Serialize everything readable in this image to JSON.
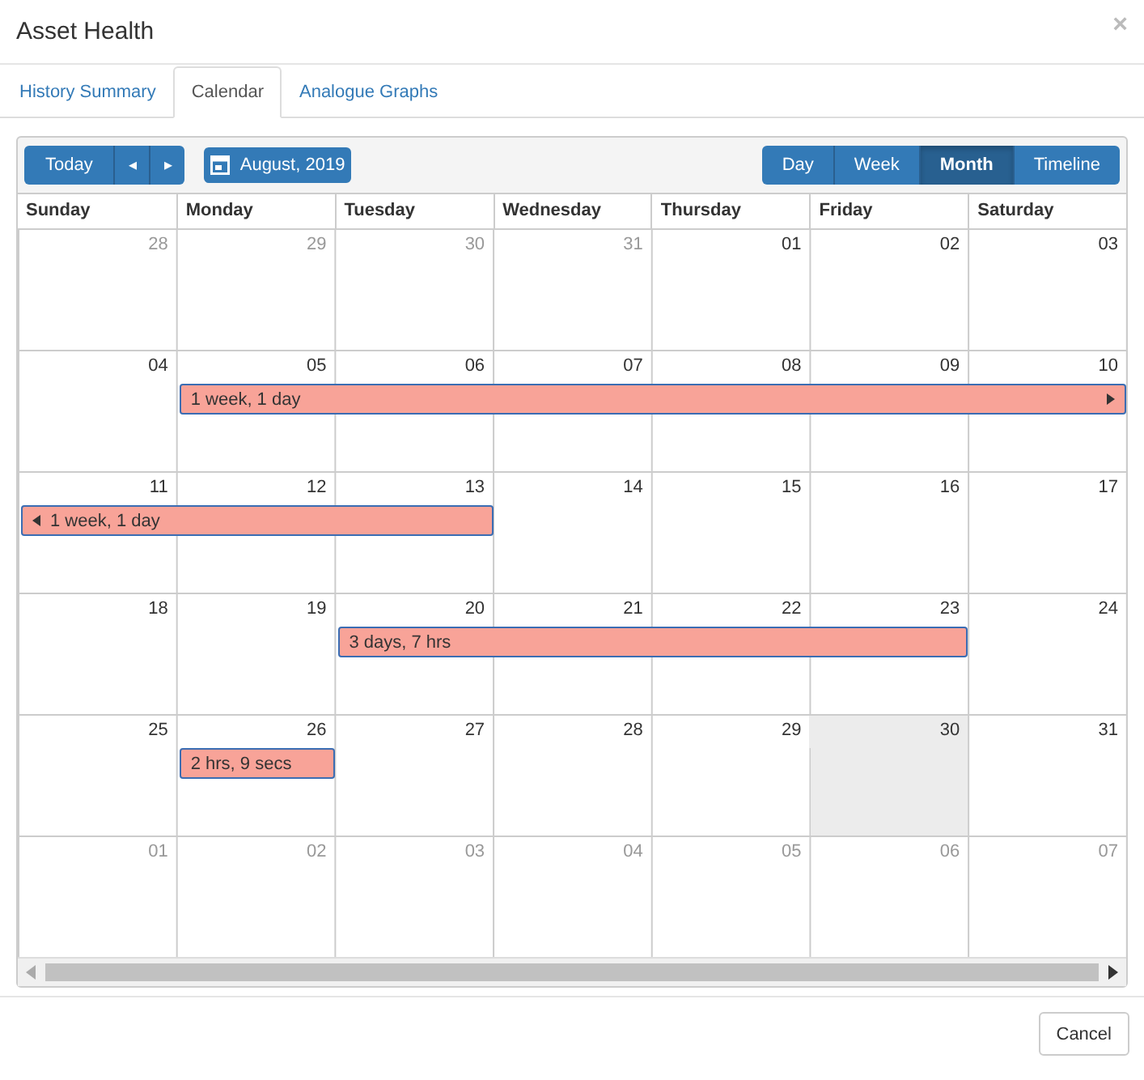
{
  "window": {
    "title": "Asset Health",
    "close": "×"
  },
  "tabs": [
    {
      "label": "History Summary",
      "selected": false
    },
    {
      "label": "Calendar",
      "selected": true
    },
    {
      "label": "Analogue Graphs",
      "selected": false
    }
  ],
  "toolbar": {
    "today": "Today",
    "prev": "◂",
    "next": "▸",
    "date": "August, 2019",
    "views": [
      {
        "label": "Day",
        "selected": false
      },
      {
        "label": "Week",
        "selected": false
      },
      {
        "label": "Month",
        "selected": true
      },
      {
        "label": "Timeline",
        "selected": false
      }
    ]
  },
  "weekdays": [
    "Sunday",
    "Monday",
    "Tuesday",
    "Wednesday",
    "Thursday",
    "Friday",
    "Saturday"
  ],
  "weeks": [
    {
      "days": [
        {
          "label": "28",
          "muted": true,
          "today": false
        },
        {
          "label": "29",
          "muted": true,
          "today": false
        },
        {
          "label": "30",
          "muted": true,
          "today": false
        },
        {
          "label": "31",
          "muted": true,
          "today": false
        },
        {
          "label": "01",
          "muted": false,
          "today": false
        },
        {
          "label": "02",
          "muted": false,
          "today": false
        },
        {
          "label": "03",
          "muted": false,
          "today": false
        }
      ]
    },
    {
      "days": [
        {
          "label": "04",
          "muted": false,
          "today": false,
          "in_event": false
        },
        {
          "label": "05",
          "muted": false,
          "today": false,
          "in_event": true
        },
        {
          "label": "06",
          "muted": false,
          "today": false,
          "in_event": true
        },
        {
          "label": "07",
          "muted": false,
          "today": false,
          "in_event": true
        },
        {
          "label": "08",
          "muted": false,
          "today": false,
          "in_event": true
        },
        {
          "label": "09",
          "muted": false,
          "today": false,
          "in_event": true
        },
        {
          "label": "10",
          "muted": false,
          "today": false,
          "in_event": true
        }
      ],
      "event": {
        "label": "1 week, 1 day",
        "continues_before": false,
        "continues_after": true
      }
    },
    {
      "days": [
        {
          "label": "11",
          "muted": false,
          "today": false,
          "in_event": true
        },
        {
          "label": "12",
          "muted": false,
          "today": false,
          "in_event": true
        },
        {
          "label": "13",
          "muted": false,
          "today": false,
          "in_event": true
        },
        {
          "label": "14",
          "muted": false,
          "today": false,
          "in_event": false
        },
        {
          "label": "15",
          "muted": false,
          "today": false,
          "in_event": false
        },
        {
          "label": "16",
          "muted": false,
          "today": false,
          "in_event": false
        },
        {
          "label": "17",
          "muted": false,
          "today": false,
          "in_event": false
        }
      ],
      "event": {
        "label": "1 week, 1 day",
        "continues_before": true,
        "continues_after": false
      }
    },
    {
      "days": [
        {
          "label": "18",
          "muted": false,
          "today": false,
          "in_event": false
        },
        {
          "label": "19",
          "muted": false,
          "today": false,
          "in_event": false
        },
        {
          "label": "20",
          "muted": false,
          "today": false,
          "in_event": true
        },
        {
          "label": "21",
          "muted": false,
          "today": false,
          "in_event": true
        },
        {
          "label": "22",
          "muted": false,
          "today": false,
          "in_event": true
        },
        {
          "label": "23",
          "muted": false,
          "today": false,
          "in_event": true
        },
        {
          "label": "24",
          "muted": false,
          "today": false,
          "in_event": false
        }
      ],
      "event": {
        "label": "3 days, 7 hrs",
        "continues_before": false,
        "continues_after": false
      }
    },
    {
      "days": [
        {
          "label": "25",
          "muted": false,
          "today": false,
          "in_event": false
        },
        {
          "label": "26",
          "muted": false,
          "today": false,
          "in_event": true
        },
        {
          "label": "27",
          "muted": false,
          "today": false,
          "in_event": false
        },
        {
          "label": "28",
          "muted": false,
          "today": false,
          "in_event": false
        },
        {
          "label": "29",
          "muted": false,
          "today": false,
          "in_event": false
        },
        {
          "label": "30",
          "muted": false,
          "today": true,
          "in_event": false
        },
        {
          "label": "31",
          "muted": false,
          "today": false,
          "in_event": false
        }
      ],
      "event": {
        "label": "2 hrs, 9 secs",
        "continues_before": false,
        "continues_after": false
      }
    },
    {
      "days": [
        {
          "label": "01",
          "muted": true,
          "today": false
        },
        {
          "label": "02",
          "muted": true,
          "today": false
        },
        {
          "label": "03",
          "muted": true,
          "today": false
        },
        {
          "label": "04",
          "muted": true,
          "today": false
        },
        {
          "label": "05",
          "muted": true,
          "today": false
        },
        {
          "label": "06",
          "muted": true,
          "today": false
        },
        {
          "label": "07",
          "muted": true,
          "today": false
        }
      ]
    }
  ],
  "footer": {
    "cancel": "Cancel"
  }
}
